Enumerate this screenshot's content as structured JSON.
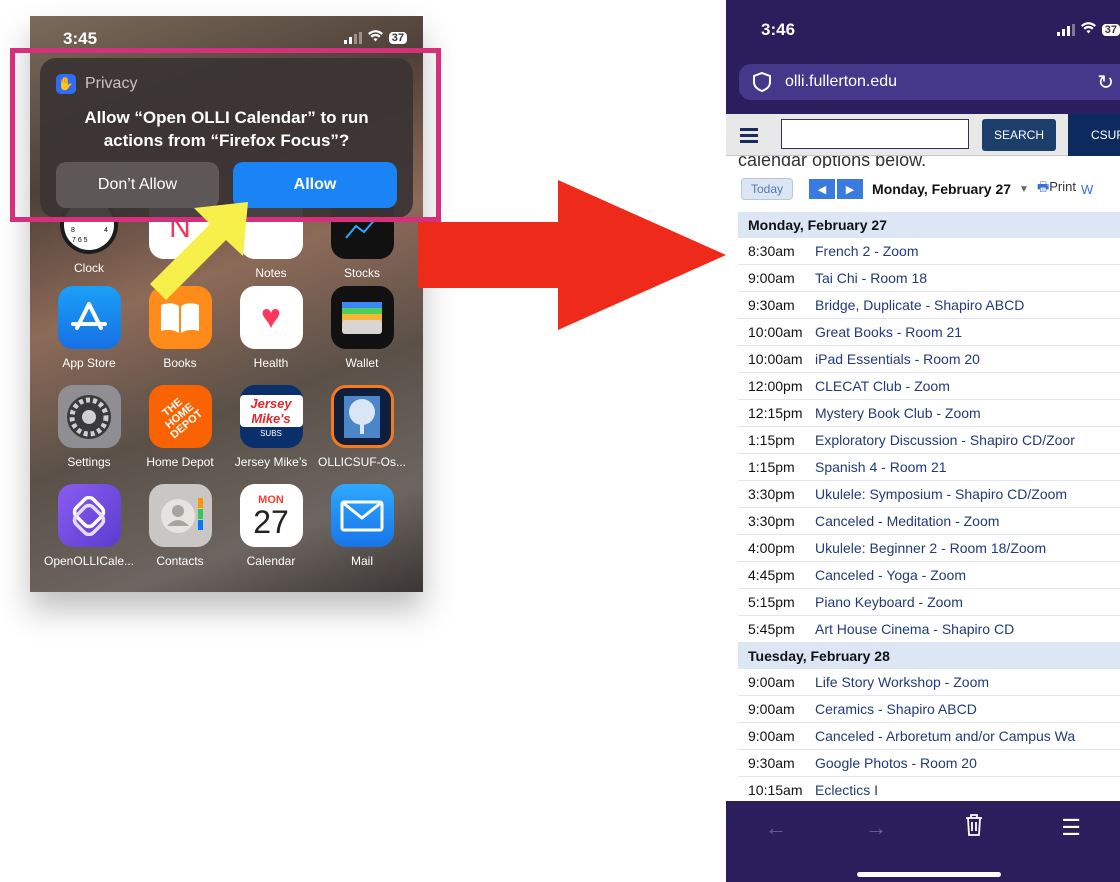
{
  "left_phone": {
    "time": "3:45",
    "battery": "37",
    "dialog": {
      "header": "Privacy",
      "message_line1": "Allow “Open OLLI Calendar” to run",
      "message_line2": "actions from “Firefox Focus”?",
      "deny_label": "Don’t Allow",
      "allow_label": "Allow"
    },
    "apps": [
      {
        "label": "Clock"
      },
      {
        "label": "Ne"
      },
      {
        "label": "Notes"
      },
      {
        "label": "Stocks"
      },
      {
        "label": "App Store"
      },
      {
        "label": "Books"
      },
      {
        "label": "Health"
      },
      {
        "label": "Wallet"
      },
      {
        "label": "Settings"
      },
      {
        "label": "Home Depot"
      },
      {
        "label": "Jersey Mike’s"
      },
      {
        "label": "OLLICSUF-Os..."
      },
      {
        "label": "OpenOLLICale..."
      },
      {
        "label": "Contacts"
      },
      {
        "label": "Calendar"
      },
      {
        "label": "Mail"
      }
    ],
    "calendar_icon": {
      "month": "MON",
      "day": "27"
    },
    "home_depot_text": "THE HOME DEPOT",
    "jersey_text": "Jersey Mike's",
    "jersey_sub": "SUBS"
  },
  "right_phone": {
    "time": "3:46",
    "battery": "37",
    "url": "olli.fullerton.edu",
    "search_label": "SEARCH",
    "csuf_label": "CSUF",
    "cut_text": "calendar options below.",
    "today_label": "Today",
    "date_title": "Monday, February 27",
    "print_label": "Print",
    "w_label": "W",
    "days": [
      {
        "heading": "Monday, February 27",
        "events": [
          {
            "time": "8:30am",
            "name": "French 2 - Zoom"
          },
          {
            "time": "9:00am",
            "name": "Tai Chi - Room 18"
          },
          {
            "time": "9:30am",
            "name": "Bridge, Duplicate - Shapiro ABCD"
          },
          {
            "time": "10:00am",
            "name": "Great Books - Room 21"
          },
          {
            "time": "10:00am",
            "name": "iPad Essentials - Room 20"
          },
          {
            "time": "12:00pm",
            "name": "CLECAT Club - Zoom"
          },
          {
            "time": "12:15pm",
            "name": "Mystery Book Club - Zoom"
          },
          {
            "time": "1:15pm",
            "name": "Exploratory Discussion - Shapiro CD/Zoor"
          },
          {
            "time": "1:15pm",
            "name": "Spanish 4 - Room 21"
          },
          {
            "time": "3:30pm",
            "name": "Ukulele: Symposium - Shapiro CD/Zoom"
          },
          {
            "time": "3:30pm",
            "name": "Canceled - Meditation - Zoom"
          },
          {
            "time": "4:00pm",
            "name": "Ukulele: Beginner 2 - Room 18/Zoom"
          },
          {
            "time": "4:45pm",
            "name": "Canceled - Yoga - Zoom"
          },
          {
            "time": "5:15pm",
            "name": "Piano Keyboard - Zoom"
          },
          {
            "time": "5:45pm",
            "name": "Art House Cinema - Shapiro CD"
          }
        ]
      },
      {
        "heading": "Tuesday, February 28",
        "events": [
          {
            "time": "9:00am",
            "name": "Life Story Workshop - Zoom"
          },
          {
            "time": "9:00am",
            "name": "Ceramics - Shapiro ABCD"
          },
          {
            "time": "9:00am",
            "name": "Canceled - Arboretum and/or Campus Wa"
          },
          {
            "time": "9:30am",
            "name": "Google Photos - Room 20"
          },
          {
            "time": "10:15am",
            "name": "Eclectics I"
          }
        ]
      }
    ]
  },
  "colors": {
    "highlight": "#d62f7c",
    "allow_blue": "#1a84f7",
    "red_arrow": "#ee2a1b",
    "yellow_arrow": "#f7ef4a",
    "browser_bg": "#2a1f5c"
  }
}
